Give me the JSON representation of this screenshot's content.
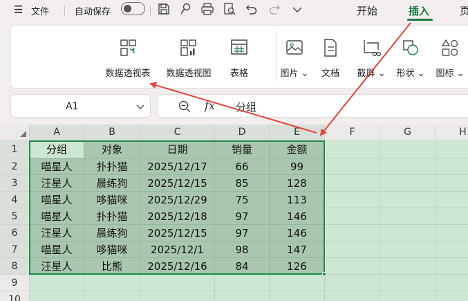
{
  "titlebar": {
    "file_label": "文件",
    "autosave_label": "自动保存",
    "tabs": {
      "start": "开始",
      "insert": "插入",
      "next_partial": "页"
    }
  },
  "ribbon": {
    "pivot_table": "数据透视表",
    "pivot_chart": "数据透视图",
    "table": "表格",
    "picture": "图片",
    "document": "文档",
    "screenshot": "截屏",
    "shape": "形状",
    "icon": "图标"
  },
  "formula": {
    "name_box": "A1",
    "fx_label": "fx",
    "value": "分组"
  },
  "sheet": {
    "columns": [
      "A",
      "B",
      "C",
      "D",
      "E",
      "F",
      "G",
      "H"
    ],
    "rows": [
      "1",
      "2",
      "3",
      "4",
      "5",
      "6",
      "7",
      "8",
      "9",
      "10"
    ],
    "data": [
      [
        "分组",
        "对象",
        "日期",
        "销量",
        "金额"
      ],
      [
        "喵星人",
        "扑扑猫",
        "2025/12/17",
        "66",
        "99"
      ],
      [
        "汪星人",
        "晨练狗",
        "2025/12/15",
        "85",
        "128"
      ],
      [
        "喵星人",
        "哆猫咪",
        "2025/12/29",
        "75",
        "113"
      ],
      [
        "喵星人",
        "扑扑猫",
        "2025/12/18",
        "97",
        "146"
      ],
      [
        "汪星人",
        "晨练狗",
        "2025/12/15",
        "97",
        "146"
      ],
      [
        "喵星人",
        "哆猫咪",
        "2025/12/1",
        "98",
        "147"
      ],
      [
        "汪星人",
        "比熊",
        "2025/12/16",
        "84",
        "126"
      ]
    ]
  },
  "colors": {
    "accent": "#1b7a42",
    "arrow": "#e0443a",
    "sheet_fill": "#cde8d2"
  }
}
